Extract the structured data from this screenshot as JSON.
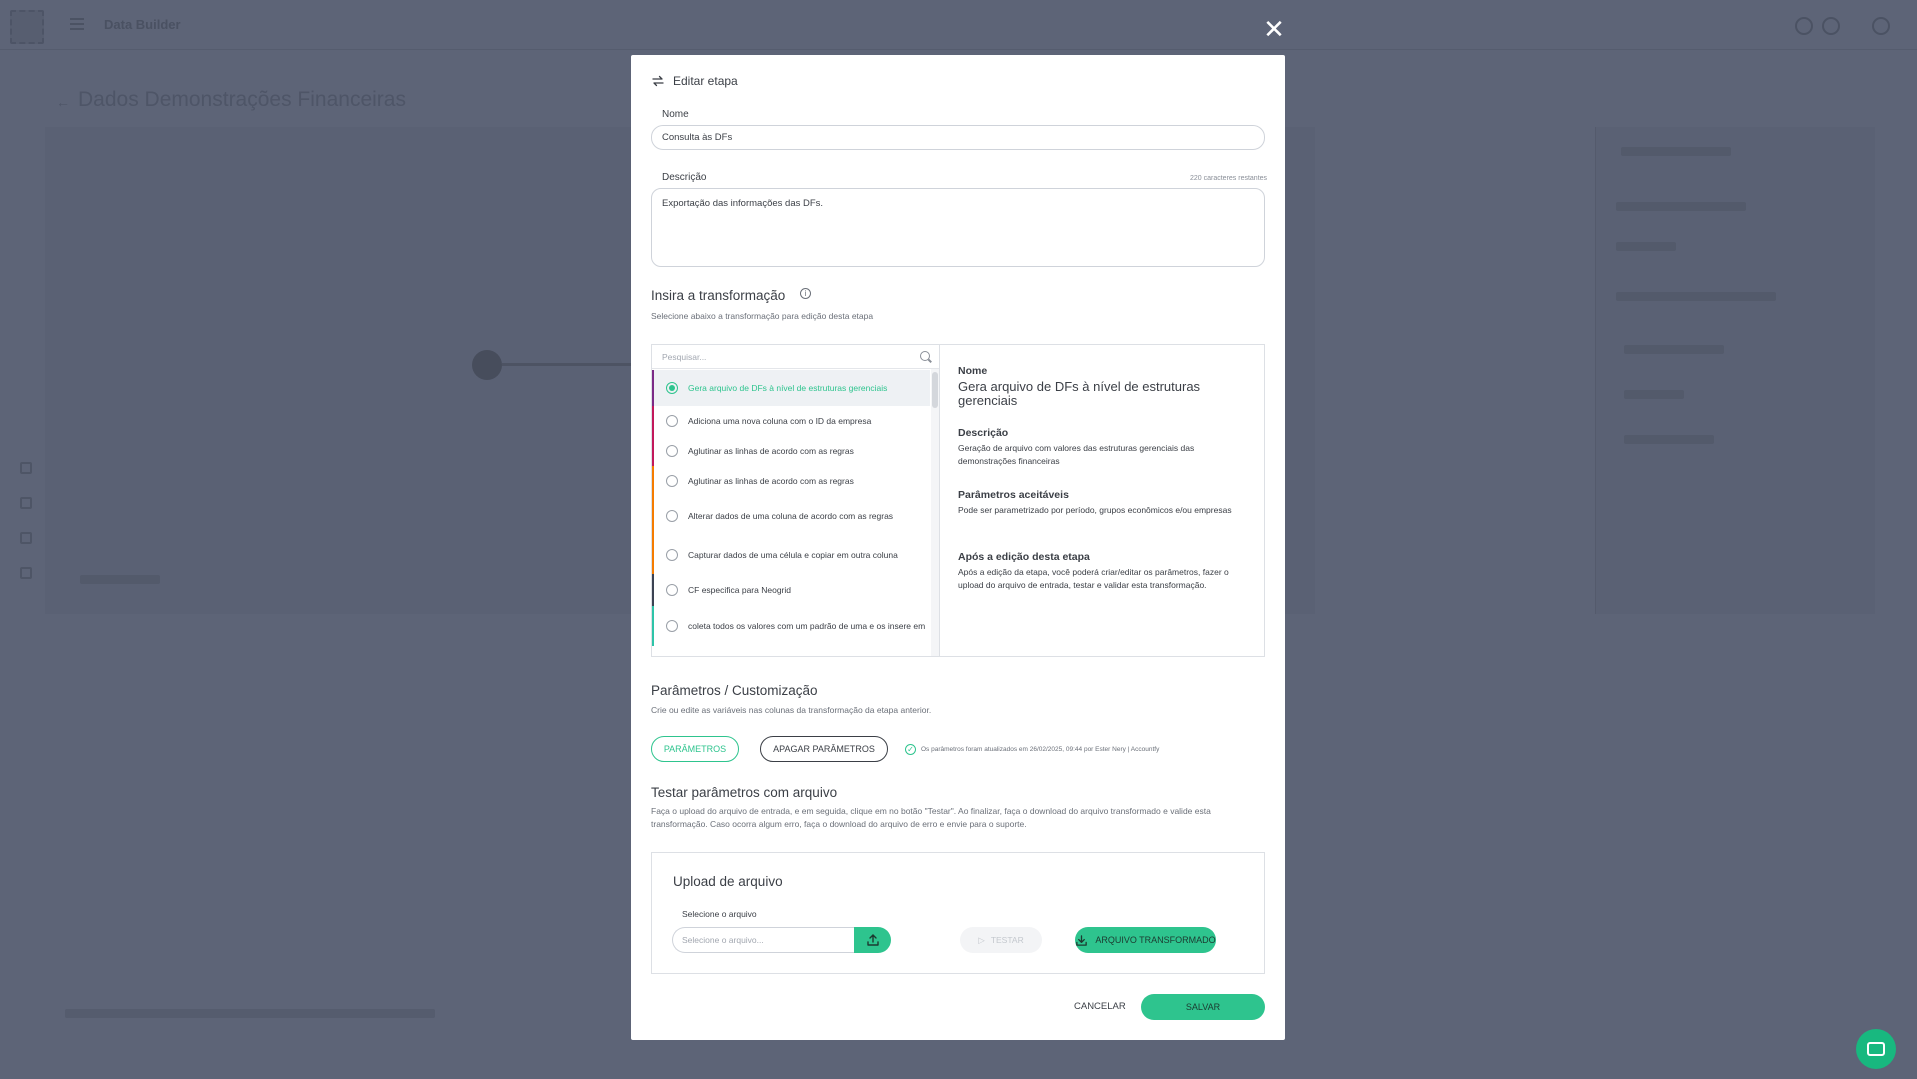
{
  "background": {
    "app_name": "Data Builder",
    "page_title": "Dados Demonstrações Financeiras"
  },
  "modal": {
    "header": "Editar etapa",
    "name_label": "Nome",
    "name_value": "Consulta às DFs",
    "description_label": "Descrição",
    "chars_remaining": "220 caracteres restantes",
    "description_value": "Exportação das informações das DFs.",
    "transform_title": "Insira a transformação",
    "transform_subtitle": "Selecione abaixo a transformação para edição desta etapa",
    "search_placeholder": "Pesquisar...",
    "options": [
      {
        "label": "Gera arquivo de DFs à nível de estruturas gerenciais",
        "color": "#7b2a86",
        "selected": true
      },
      {
        "label": "Adiciona uma nova coluna com o ID da empresa",
        "color": "#c2185b",
        "selected": false
      },
      {
        "label": "Aglutinar as linhas de acordo com as regras",
        "color": "#c2185b",
        "selected": false
      },
      {
        "label": "Aglutinar as linhas de acordo com as regras",
        "color": "#f57c00",
        "selected": false
      },
      {
        "label": "Alterar dados de uma coluna de acordo com as regras",
        "color": "#f57c00",
        "selected": false
      },
      {
        "label": "Capturar dados de uma célula e copiar em outra coluna",
        "color": "#f57c00",
        "selected": false
      },
      {
        "label": "CF especifica para Neogrid",
        "color": "#3b4252",
        "selected": false
      },
      {
        "label": "coleta todos os valores com um padrão de uma e os insere em",
        "color": "#2ec4a8",
        "selected": false
      }
    ],
    "detail": {
      "name_heading": "Nome",
      "name_value": "Gera arquivo de DFs à nível de estruturas gerenciais",
      "desc_heading": "Descrição",
      "desc_value": "Geração de arquivo com valores das estruturas gerenciais das demonstrações financeiras",
      "params_heading": "Parâmetros aceitáveis",
      "params_value": "Pode ser parametrizado por período, grupos econômicos e/ou empresas",
      "after_heading": "Após a edição desta etapa",
      "after_value": "Após a edição da etapa, você poderá criar/editar os parâmetros, fazer o upload do arquivo de entrada, testar e validar esta transformação."
    },
    "params_title": "Parâmetros / Customização",
    "params_subtitle": "Crie ou edite as variáveis nas colunas da transformação da etapa anterior.",
    "params_button": "PARÂMETROS",
    "clear_params_button": "APAGAR PARÂMETROS",
    "params_status": "Os parâmetros foram atualizados em 26/02/2025, 09:44 por Ester Nery | Accountfy",
    "test_title": "Testar parâmetros com arquivo",
    "test_subtitle": "Faça o upload do arquivo de entrada, e em seguida, clique em no botão \"Testar\". Ao finalizar, faça o download do arquivo transformado e valide esta transformação. Caso ocorra algum erro, faça o download do arquivo de erro e envie para o suporte.",
    "upload_title": "Upload de arquivo",
    "select_file_label": "Selecione o arquivo",
    "file_placeholder": "Selecione o arquivo...",
    "test_button": "TESTAR",
    "transformed_button": "ARQUIVO TRANSFORMADO",
    "cancel_button": "CANCELAR",
    "save_button": "SALVAR"
  },
  "colors": {
    "accent": "#2ec48e",
    "overlay": "#5d6477",
    "chat": "#18b87f"
  }
}
